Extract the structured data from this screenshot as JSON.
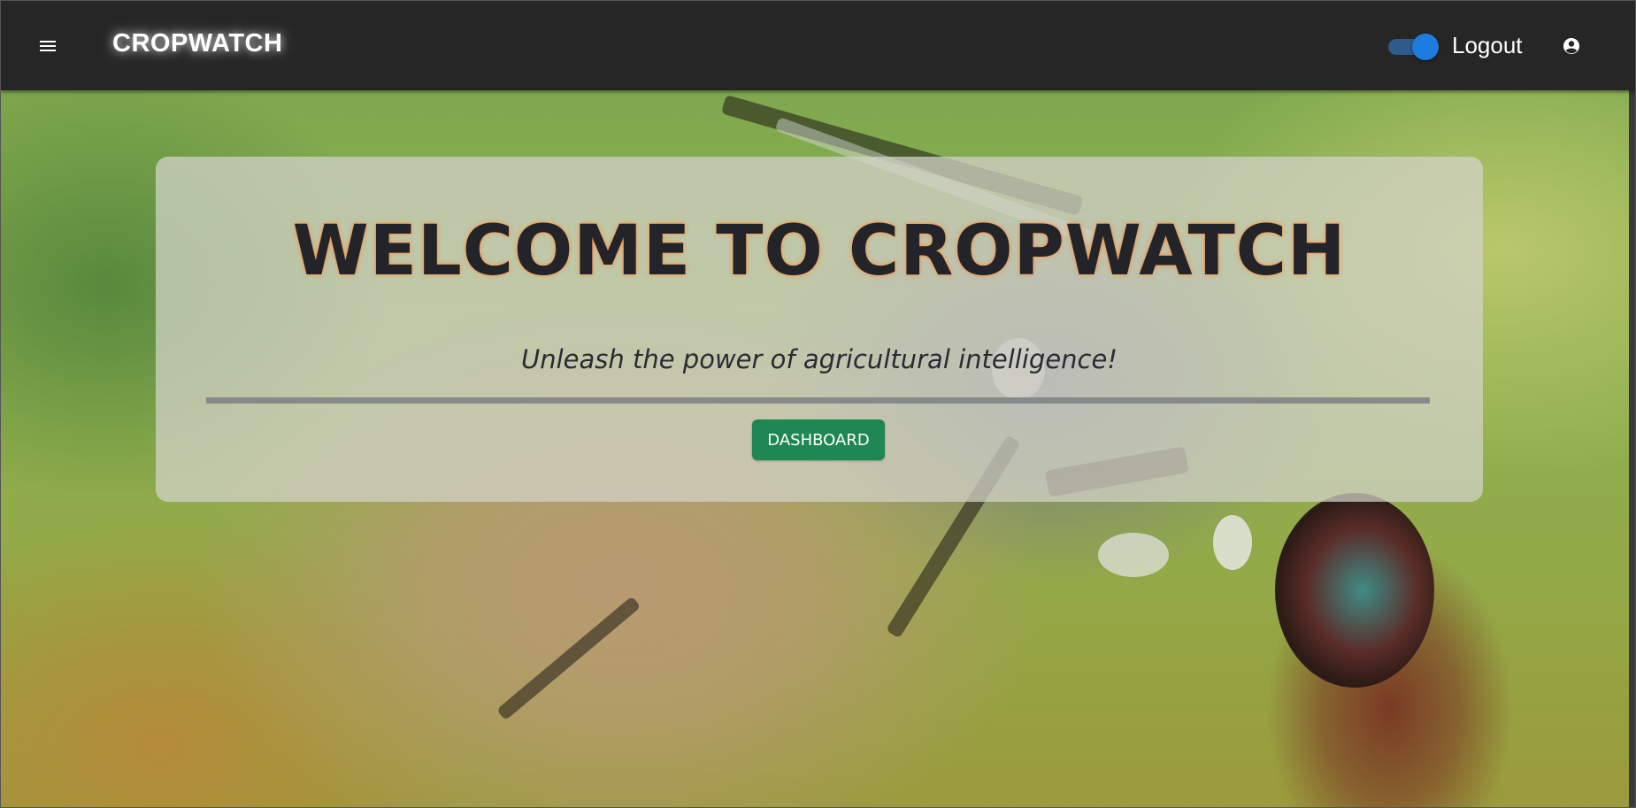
{
  "header": {
    "menu_icon": "hamburger-menu-icon",
    "brand": "CROPWATCH",
    "theme_toggle": {
      "on": true,
      "accent": "#1e7ce0"
    },
    "logout_label": "Logout",
    "account_icon": "account-circle-icon",
    "background": "#262626"
  },
  "hero": {
    "title": "WELCOME TO CROPWATCH",
    "tagline": "Unleash the power of agricultural intelligence!",
    "dashboard_button": "DASHBOARD",
    "button_color": "#1f8754"
  }
}
